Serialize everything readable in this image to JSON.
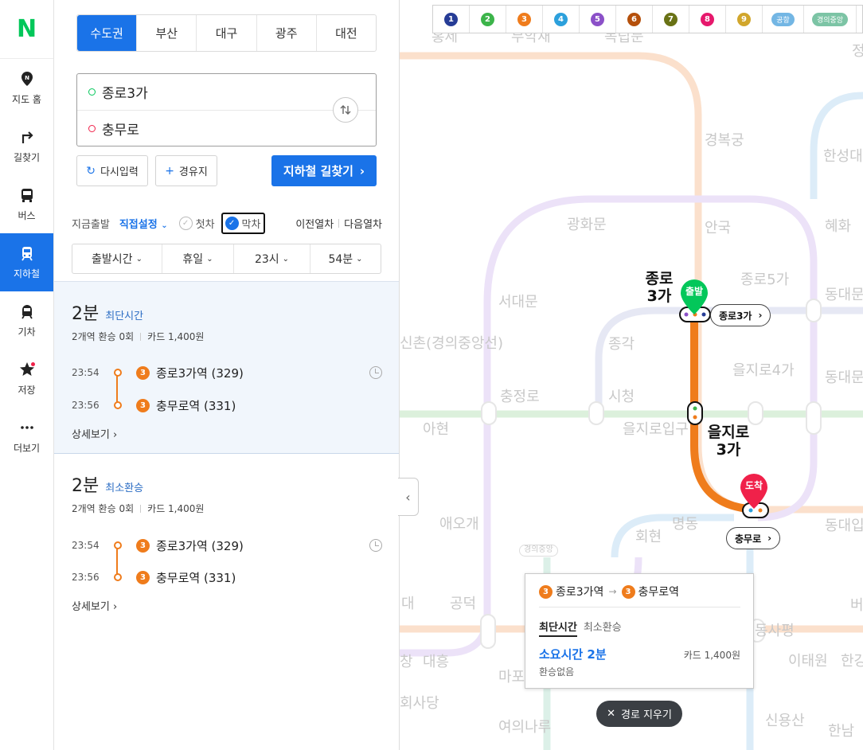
{
  "rail": {
    "logo": "N",
    "items": [
      {
        "label": "지도 홈",
        "icon": "map-pin-icon"
      },
      {
        "label": "길찾기",
        "icon": "turn-arrow-icon"
      },
      {
        "label": "버스",
        "icon": "bus-icon"
      },
      {
        "label": "지하철",
        "icon": "subway-icon",
        "active": true
      },
      {
        "label": "기차",
        "icon": "train-icon"
      },
      {
        "label": "저장",
        "icon": "star-icon"
      },
      {
        "label": "더보기",
        "icon": "more-icon"
      }
    ]
  },
  "regions": [
    "수도권",
    "부산",
    "대구",
    "광주",
    "대전"
  ],
  "search": {
    "start": "종로3가",
    "end": "충무로",
    "reset_label": "다시입력",
    "via_label": "경유지",
    "find_label": "지하철 길찾기"
  },
  "options": {
    "now_label": "지금출발",
    "set_label": "직접설정",
    "first_label": "첫차",
    "last_label": "막차",
    "prev_label": "이전열차",
    "next_label": "다음열차"
  },
  "time_select": {
    "mode": "출발시간",
    "day": "휴일",
    "hour": "23시",
    "minute": "54분"
  },
  "results": [
    {
      "duration": "2분",
      "tag": "최단시간",
      "stations_text": "2개역",
      "transfer_label": "환승",
      "transfer_count": "0회",
      "fare": "카드 1,400원",
      "legs": [
        {
          "time": "23:54",
          "line": "3",
          "station": "종로3가역 (329)"
        },
        {
          "time": "23:56",
          "line": "3",
          "station": "충무로역 (331)"
        }
      ],
      "detail_label": "상세보기"
    },
    {
      "duration": "2분",
      "tag": "최소환승",
      "stations_text": "2개역",
      "transfer_label": "환승",
      "transfer_count": "0회",
      "fare": "카드 1,400원",
      "legs": [
        {
          "time": "23:54",
          "line": "3",
          "station": "종로3가역 (329)"
        },
        {
          "time": "23:56",
          "line": "3",
          "station": "충무로역 (331)"
        }
      ],
      "detail_label": "상세보기"
    }
  ],
  "line_legend": [
    {
      "label": "1",
      "color": "#263c96"
    },
    {
      "label": "2",
      "color": "#3cb44a"
    },
    {
      "label": "3",
      "color": "#ef7c1c"
    },
    {
      "label": "4",
      "color": "#2ca0dc"
    },
    {
      "label": "5",
      "color": "#8b50c8"
    },
    {
      "label": "6",
      "color": "#b5500b"
    },
    {
      "label": "7",
      "color": "#697215"
    },
    {
      "label": "8",
      "color": "#e6186c"
    },
    {
      "label": "9",
      "color": "#d1a62c"
    },
    {
      "label": "공항",
      "color": "#73b6e4"
    },
    {
      "label": "경의중앙",
      "color": "#7cc4a5"
    }
  ],
  "map": {
    "labels": [
      "홍제",
      "무악재",
      "독립문",
      "정",
      "경복궁",
      "한성대입구",
      "광화문",
      "안국",
      "혜화",
      "서대문",
      "종로5가",
      "동대문",
      "신촌(경의중앙선)",
      "종각",
      "을지로4가",
      "동대문역사문화공원",
      "충정로",
      "시청",
      "아현",
      "을지로입구",
      "애오개",
      "명동",
      "회현",
      "동대입구",
      "경의중앙",
      "대",
      "공덕",
      "동사평",
      "버티",
      "창",
      "대흥",
      "마포",
      "이태원",
      "한강",
      "회사당",
      "여의나루",
      "신용산",
      "한남"
    ],
    "start_station": "종로3가",
    "mid_station": "을지로3가",
    "end_station": "충무로",
    "start_pin": "출발",
    "end_pin": "도착"
  },
  "popup": {
    "from": "종로3가역",
    "to": "충무로역",
    "line": "3",
    "tab_active": "최단시간",
    "tab_other": "최소환승",
    "duration": "소요시간 2분",
    "fare": "카드 1,400원",
    "transfer": "환승없음"
  },
  "clear_label": "경로 지우기"
}
